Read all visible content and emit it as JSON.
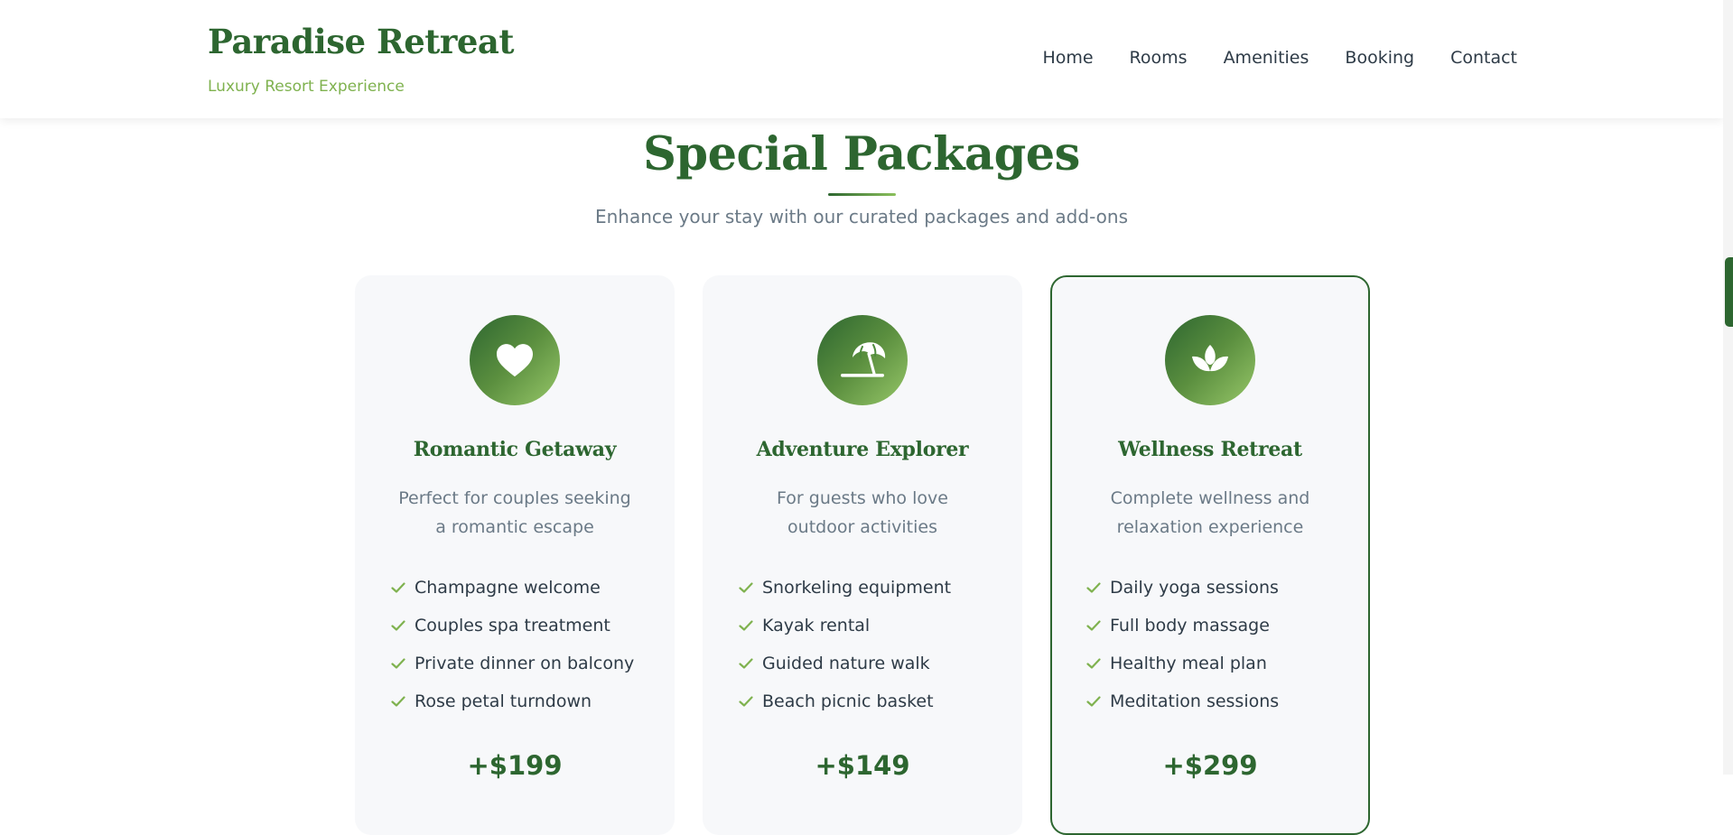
{
  "header": {
    "brand_name": "Paradise Retreat",
    "tagline": "Luxury Resort Experience",
    "nav": [
      "Home",
      "Rooms",
      "Amenities",
      "Booking",
      "Contact"
    ]
  },
  "section": {
    "title": "Special Packages",
    "subtitle": "Enhance your stay with our curated packages and add-ons"
  },
  "packages": [
    {
      "icon": "heart-icon",
      "name": "Romantic Getaway",
      "description": "Perfect for couples seeking a romantic escape",
      "features": [
        "Champagne welcome",
        "Couples spa treatment",
        "Private dinner on balcony",
        "Rose petal turndown"
      ],
      "price": "+$199",
      "featured": false
    },
    {
      "icon": "beach-umbrella-icon",
      "name": "Adventure Explorer",
      "description": "For guests who love outdoor activities",
      "features": [
        "Snorkeling equipment",
        "Kayak rental",
        "Guided nature walk",
        "Beach picnic basket"
      ],
      "price": "+$149",
      "featured": false
    },
    {
      "icon": "lotus-icon",
      "name": "Wellness Retreat",
      "description": "Complete wellness and relaxation experience",
      "features": [
        "Daily yoga sessions",
        "Full body massage",
        "Healthy meal plan",
        "Meditation sessions"
      ],
      "price": "+$299",
      "featured": true
    }
  ],
  "colors": {
    "primary": "#2d6630",
    "accent": "#8bc05c",
    "card_background": "#f7f8fa",
    "muted_text": "#6b7a87"
  }
}
